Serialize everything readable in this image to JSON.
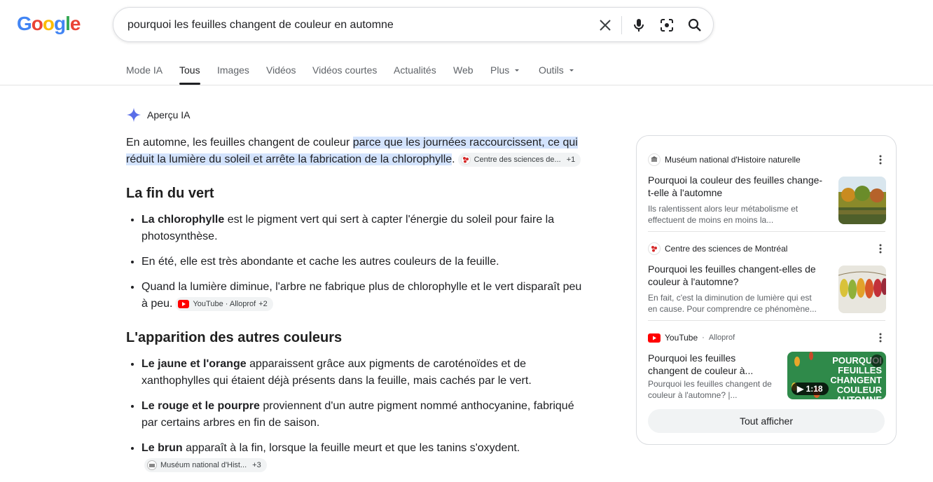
{
  "logo": {
    "letters": [
      "G",
      "o",
      "o",
      "g",
      "l",
      "e"
    ],
    "colors": [
      "#4285f4",
      "#ea4335",
      "#fbbc05",
      "#4285f4",
      "#34a853",
      "#ea4335"
    ]
  },
  "search": {
    "query": "pourquoi les feuilles changent de couleur en automne"
  },
  "tabs": [
    {
      "label": "Mode IA"
    },
    {
      "label": "Tous"
    },
    {
      "label": "Images"
    },
    {
      "label": "Vidéos"
    },
    {
      "label": "Vidéos courtes"
    },
    {
      "label": "Actualités"
    },
    {
      "label": "Web"
    },
    {
      "label": "Plus"
    },
    {
      "label": "Outils"
    }
  ],
  "ai": {
    "label": "Aperçu IA",
    "intro_plain": "En automne, les feuilles changent de couleur ",
    "intro_highlight": "parce que les journées raccourcissent, ce qui réduit la lumière du soleil et arrête la fabrication de la chlorophylle",
    "intro_end": ".",
    "chip1": {
      "name": "Centre des sciences de...",
      "plus": "+1"
    },
    "h1": "La fin du vert",
    "b1_bold": "La chlorophylle",
    "b1_text": " est le pigment vert qui sert à capter l'énergie du soleil pour faire la photosynthèse.",
    "b2_text": "En été, elle est très abondante et cache les autres couleurs de la feuille.",
    "b3_text": "Quand la lumière diminue, l'arbre ne fabrique plus de chlorophylle et le vert disparaît peu à peu.",
    "chip2": {
      "name": "YouTube · Alloprof",
      "plus": "+2"
    },
    "h2": "L'apparition des autres couleurs",
    "b4_bold": "Le jaune et l'orange",
    "b4_text": " apparaissent grâce aux pigments de caroténoïdes et de xanthophylles qui étaient déjà présents dans la feuille, mais cachés par le vert.",
    "b5_bold": "Le rouge et le pourpre",
    "b5_text": " proviennent d'un autre pigment nommé anthocyanine, fabriqué par certains arbres en fin de saison.",
    "b6_bold": "Le brun",
    "b6_text": " apparaît à la fin, lorsque la feuille meurt et que les tanins s'oxydent.",
    "chip3": {
      "name": "Muséum national d'Hist...",
      "plus": "+3"
    }
  },
  "sources": [
    {
      "site": "Muséum national d'Histoire naturelle",
      "title": "Pourquoi la couleur des feuilles change-t-elle à l'automne",
      "desc": "Ils ralentissent alors leur métabolisme et effectuent de moins en moins la..."
    },
    {
      "site": "Centre des sciences de Montréal",
      "title": "Pourquoi les feuilles changent-elles de couleur à l'automne?",
      "desc": "En fait, c'est la diminution de lumière qui est en cause. Pour comprendre ce phénomène..."
    },
    {
      "site": "YouTube",
      "sub": "Alloprof",
      "title": "Pourquoi les feuilles changent de couleur à...",
      "desc": "Pourquoi les feuilles changent de couleur à l'automne? |...",
      "video_text": "POURQUOI FEUILLES CHANGENT COULEUR AUTOMNE",
      "duration": "1:18"
    }
  ],
  "show_all": "Tout afficher"
}
